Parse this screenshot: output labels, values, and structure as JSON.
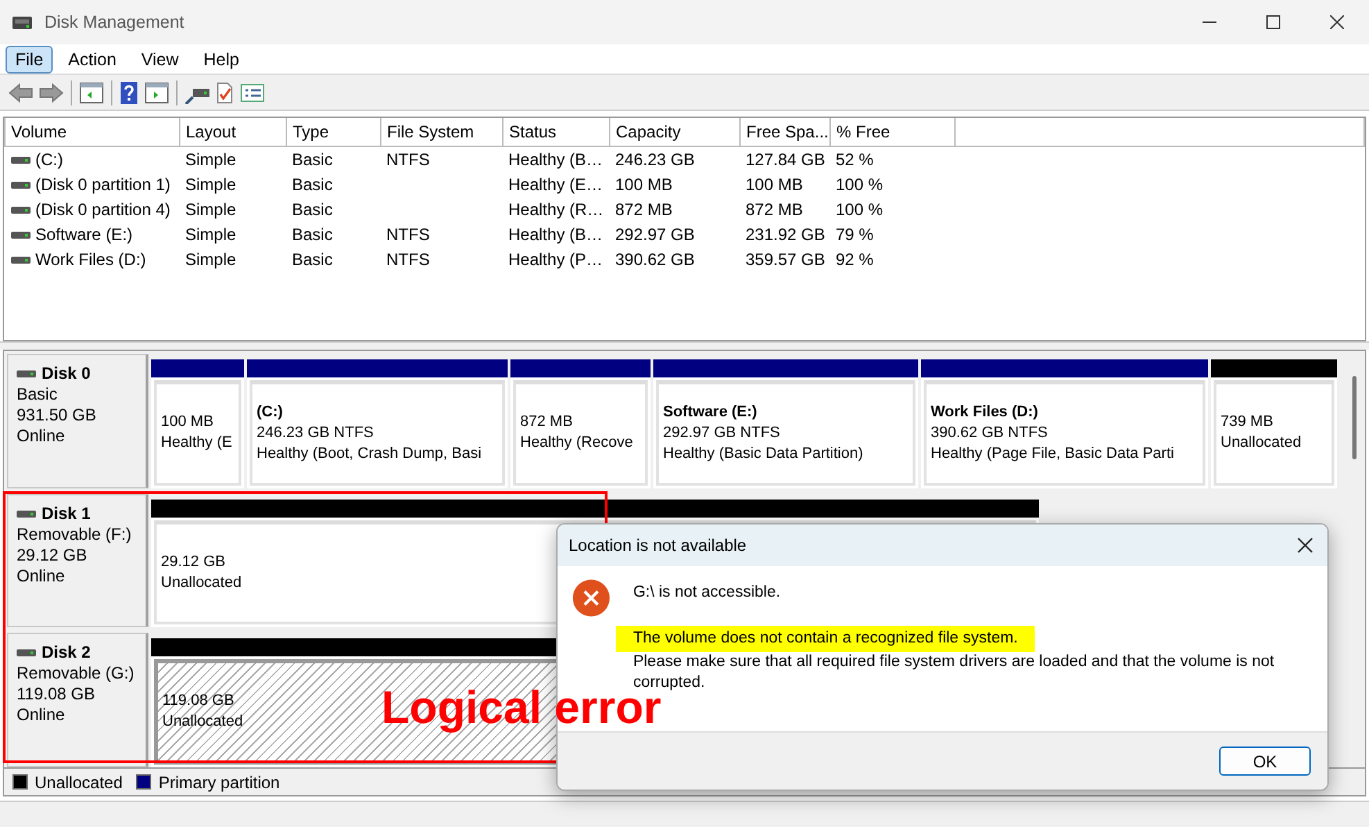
{
  "window": {
    "title": "Disk Management"
  },
  "menu": [
    {
      "label": "File",
      "selected": true
    },
    {
      "label": "Action",
      "selected": false
    },
    {
      "label": "View",
      "selected": false
    },
    {
      "label": "Help",
      "selected": false
    }
  ],
  "volumes": {
    "columns": [
      "Volume",
      "Layout",
      "Type",
      "File System",
      "Status",
      "Capacity",
      "Free Spa...",
      "% Free"
    ],
    "rows": [
      {
        "cells": [
          "(C:)",
          "Simple",
          "Basic",
          "NTFS",
          "Healthy (B…",
          "246.23 GB",
          "127.84 GB",
          "52 %"
        ]
      },
      {
        "cells": [
          "(Disk 0 partition 1)",
          "Simple",
          "Basic",
          "",
          "Healthy (E…",
          "100 MB",
          "100 MB",
          "100 %"
        ]
      },
      {
        "cells": [
          "(Disk 0 partition 4)",
          "Simple",
          "Basic",
          "",
          "Healthy (R…",
          "872 MB",
          "872 MB",
          "100 %"
        ]
      },
      {
        "cells": [
          "Software (E:)",
          "Simple",
          "Basic",
          "NTFS",
          "Healthy (B…",
          "292.97 GB",
          "231.92 GB",
          "79 %"
        ]
      },
      {
        "cells": [
          "Work Files (D:)",
          "Simple",
          "Basic",
          "NTFS",
          "Healthy (P…",
          "390.62 GB",
          "359.57 GB",
          "92 %"
        ]
      }
    ]
  },
  "disks": [
    {
      "name": "Disk 0",
      "type": "Basic",
      "size": "931.50 GB",
      "status": "Online",
      "partitions": [
        {
          "kind": "primary",
          "selected": false,
          "size": "100 MB",
          "status": "Healthy (E"
        },
        {
          "kind": "primary",
          "selected": false,
          "name": "(C:)",
          "size": "246.23 GB NTFS",
          "status": "Healthy (Boot, Crash Dump, Basi"
        },
        {
          "kind": "primary",
          "selected": false,
          "size": "872 MB",
          "status": "Healthy (Recove"
        },
        {
          "kind": "primary",
          "selected": false,
          "name": "Software  (E:)",
          "size": "292.97 GB NTFS",
          "status": "Healthy (Basic Data Partition)"
        },
        {
          "kind": "primary",
          "selected": false,
          "name": "Work Files  (D:)",
          "size": "390.62 GB NTFS",
          "status": "Healthy (Page File, Basic Data Parti"
        },
        {
          "kind": "unallocated",
          "selected": false,
          "size": "739 MB",
          "status": "Unallocated"
        }
      ]
    },
    {
      "name": "Disk 1",
      "type": "Removable (F:)",
      "size": "29.12 GB",
      "status": "Online",
      "partitions": [
        {
          "kind": "unallocated",
          "selected": false,
          "size": "29.12 GB",
          "status": "Unallocated"
        }
      ]
    },
    {
      "name": "Disk 2",
      "type": "Removable (G:)",
      "size": "119.08 GB",
      "status": "Online",
      "partitions": [
        {
          "kind": "unallocated",
          "selected": true,
          "size": "119.08 GB",
          "status": "Unallocated"
        }
      ]
    }
  ],
  "legend": [
    {
      "label": "Unallocated",
      "color": "#000000"
    },
    {
      "label": "Primary partition",
      "color": "#000080"
    }
  ],
  "dialog": {
    "title": "Location is not available",
    "message": "G:\\ is not accessible.",
    "lines": [
      {
        "text": "The volume does not contain a recognized file system.",
        "highlighted": true
      },
      {
        "text": "Please make sure that all required file system drivers are loaded and that the volume is not corrupted.",
        "highlighted": false
      }
    ],
    "button": "OK"
  },
  "annotation": {
    "label": "Logical error"
  }
}
